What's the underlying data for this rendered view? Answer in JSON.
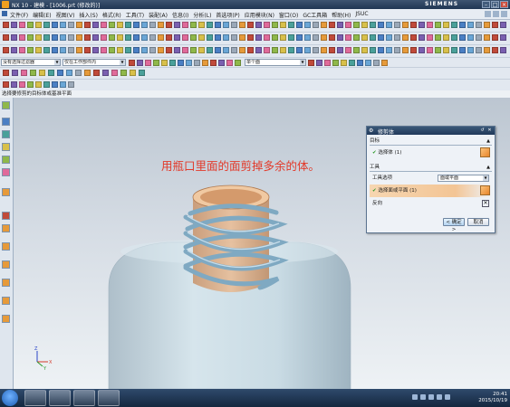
{
  "window": {
    "title": "NX 10 - 建模 - [1006.prt (修改的)]",
    "brand": "SIEMENS",
    "controls": [
      "–",
      "□",
      "×"
    ]
  },
  "menu": {
    "items": [
      "文件(F)",
      "编辑(E)",
      "视图(V)",
      "插入(S)",
      "格式(R)",
      "工具(T)",
      "装配(A)",
      "信息(I)",
      "分析(L)",
      "首选项(P)",
      "应用模块(N)",
      "窗口(O)",
      "GC工具箱",
      "帮助(H)",
      "JSUC"
    ]
  },
  "filters": {
    "selection_filter": "没有选择过滤器",
    "scope": "仅在工作部件内",
    "snap_mode": "单个面"
  },
  "prompt": {
    "text": "选择要修剪的目标体或基准平面"
  },
  "viewport": {
    "annotation": "用瓶口里面的面剪掉多余的体。",
    "triad": {
      "x": "X",
      "y": "Y",
      "z": "Z"
    }
  },
  "dialog": {
    "title": "修剪体",
    "target_section": "目标",
    "target_row": "选择体 (1)",
    "tool_section": "工具",
    "tool_option_label": "工具选项",
    "tool_option_value": "面或平面",
    "tool_row": "选择面或平面 (1)",
    "reverse_label": "反向",
    "ok": "< 确定 >",
    "cancel": "取消"
  },
  "taskbar": {
    "time": "20:41",
    "date": "2015/10/19"
  },
  "colors": {
    "annotation": "#e23a2a",
    "spring": "#7fa9c2",
    "tube": "#d9a57b",
    "bottle": "#c7dce6",
    "dialog_header": "#21395a"
  }
}
